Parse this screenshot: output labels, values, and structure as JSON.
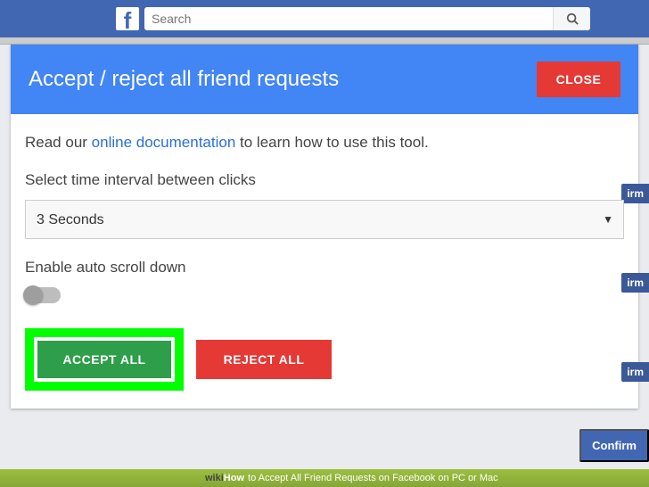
{
  "topbar": {
    "search_placeholder": "Search"
  },
  "panel": {
    "title": "Accept / reject all friend requests",
    "close_label": "CLOSE",
    "intro_lead": "Read our ",
    "intro_link": "online documentation",
    "intro_tail": " to learn how to use this tool.",
    "interval_label": "Select time interval between clicks",
    "interval_value": "3 Seconds",
    "scroll_label": "Enable auto scroll down",
    "accept_label": "ACCEPT ALL",
    "reject_label": "REJECT ALL"
  },
  "bg": {
    "pill": "irm",
    "confirm": "Confirm"
  },
  "footer": {
    "wiki": "wiki",
    "how": "How ",
    "title": "to Accept All Friend Requests on Facebook on PC or Mac"
  }
}
